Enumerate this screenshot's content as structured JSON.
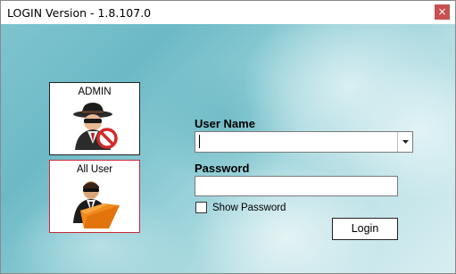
{
  "window": {
    "title": "LOGIN Version - 1.8.107.0",
    "close_glyph": "×"
  },
  "users": [
    {
      "label": "ADMIN",
      "icon": "spy-admin-icon",
      "selected": false
    },
    {
      "label": "All User",
      "icon": "agent-folder-icon",
      "selected": true
    }
  ],
  "form": {
    "username_label": "User Name",
    "username_value": "",
    "password_label": "Password",
    "password_value": "",
    "show_password_label": "Show Password",
    "show_password_checked": false,
    "login_label": "Login"
  },
  "colors": {
    "close_button": "#c75050",
    "selected_tile_border": "#c8283c"
  }
}
